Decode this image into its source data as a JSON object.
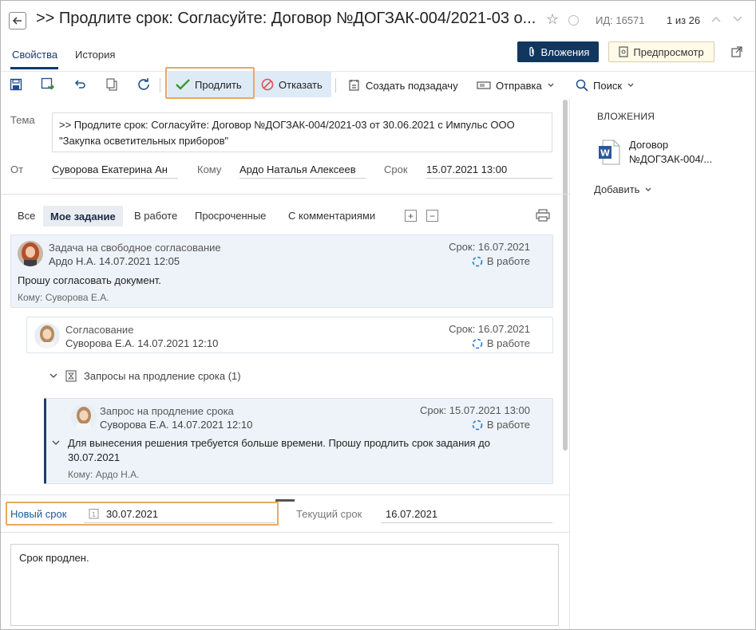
{
  "header": {
    "title": ">> Продлите срок: Согласуйте: Договор №ДОГЗАК-004/2021-03 о...",
    "id_label": "ИД: 16571",
    "counter": "1 из 26"
  },
  "tabs": [
    {
      "label": "Свойства",
      "active": true
    },
    {
      "label": "История",
      "active": false
    }
  ],
  "top_buttons": {
    "attachments": "Вложения",
    "preview": "Предпросмотр"
  },
  "toolbar": {
    "extend": "Продлить",
    "refuse": "Отказать",
    "create_subtask": "Создать подзадачу",
    "send": "Отправка",
    "search": "Поиск"
  },
  "form": {
    "subject_label": "Тема",
    "subject_value": ">> Продлите срок: Согласуйте: Договор №ДОГЗАК-004/2021-03 от 30.06.2021 с Импульс ООО \"Закупка осветительных приборов\"",
    "from_label": "От",
    "from_value": "Суворова Екатерина Ан",
    "to_label": "Кому",
    "to_value": "Ардо Наталья Алексеев",
    "due_label": "Срок",
    "due_value": "15.07.2021 13:00"
  },
  "filters": [
    {
      "label": "Все",
      "active": false
    },
    {
      "label": "Мое задание",
      "active": true
    },
    {
      "label": "В работе",
      "active": false
    },
    {
      "label": "Просроченные",
      "active": false
    },
    {
      "label": "С комментариями",
      "active": false
    }
  ],
  "tasks": [
    {
      "title": "Задача на свободное согласование",
      "author_date": "Ардо Н.А.   14.07.2021 12:05",
      "due": "Срок: 16.07.2021",
      "status": "В работе",
      "body": "Прошу согласовать документ.",
      "to": "Кому: Суворова Е.А."
    },
    {
      "title": "Согласование",
      "author_date": "Суворова Е.А.   14.07.2021 12:10",
      "due": "Срок: 16.07.2021",
      "status": "В работе"
    },
    {
      "title": "Запрос на продление срока",
      "author_date": "Суворова Е.А.   14.07.2021 12:10",
      "due": "Срок: 15.07.2021 13:00",
      "status": "В работе",
      "body": "Для вынесения решения требуется больше времени. Прошу продлить срок задания до 30.07.2021",
      "to": "Кому: Ардо Н.А."
    }
  ],
  "group": {
    "label": "Запросы на продление срока (1)"
  },
  "dates": {
    "new_label": "Новый срок",
    "new_value": "30.07.2021",
    "current_label": "Текущий срок",
    "current_value": "16.07.2021"
  },
  "comment": {
    "value": "Срок продлен."
  },
  "right_panel": {
    "title": "ВЛОЖЕНИЯ",
    "doc_name_line1": "Договор",
    "doc_name_line2": "№ДОГЗАК-004/...",
    "add_label": "Добавить"
  },
  "colors": {
    "accent_dark": "#12375f",
    "highlight": "#e8a862",
    "check_green": "#3a9a2e",
    "refuse_red": "#d9534f",
    "status_blue": "#2a7bd2"
  }
}
